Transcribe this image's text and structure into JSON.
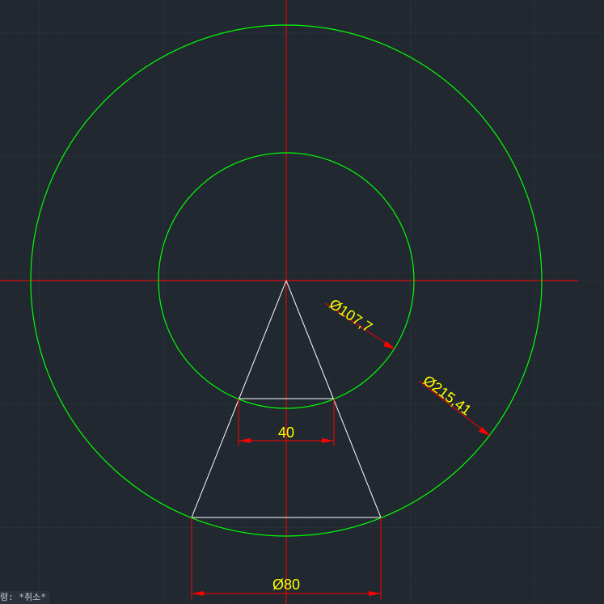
{
  "drawing": {
    "colors": {
      "background": "#212830",
      "grid_major": "#2d3640",
      "grid_minor": "#262d36",
      "centerline": "#ff0000",
      "circle": "#00ff00",
      "geometry": "#ffffff",
      "dimension_line": "#ff0000",
      "dimension_text": "#ffff00"
    },
    "dimensions": {
      "inner_diameter": "Ø107,7",
      "outer_diameter": "Ø215,41",
      "chord_width": "40",
      "base_diameter": "Ø80"
    }
  },
  "command_line": {
    "text": "령: *취소*"
  }
}
